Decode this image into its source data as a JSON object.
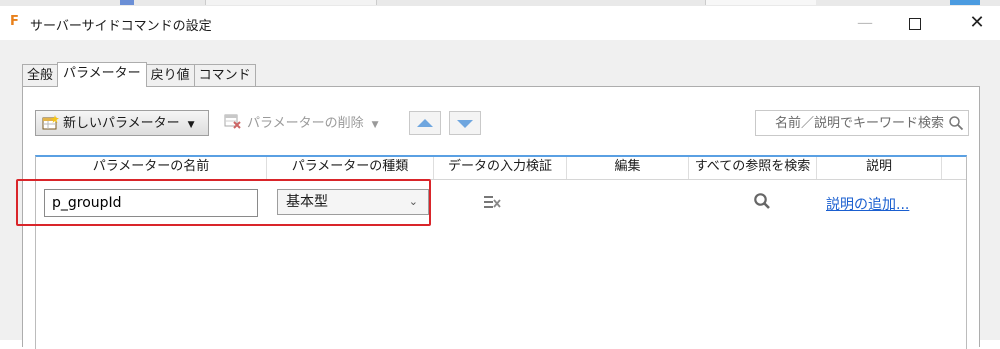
{
  "window": {
    "title": "サーバーサイドコマンドの設定",
    "app_icon_letter": "F",
    "accent_color": "#e8801a",
    "controls": {
      "minimize": "—",
      "close": "✕"
    }
  },
  "tabs": [
    {
      "label": "全般",
      "active": false
    },
    {
      "label": "パラメーター",
      "active": true
    },
    {
      "label": "戻り値",
      "active": false
    },
    {
      "label": "コマンド",
      "active": false
    }
  ],
  "toolbar": {
    "new_parameter_label": "新しいパラメーター",
    "delete_parameter_label": "パラメーターの削除",
    "move_up_icon": "arrow-up",
    "move_down_icon": "arrow-down",
    "search_placeholder": "名前／説明でキーワード検索"
  },
  "grid": {
    "columns": [
      "パラメーターの名前",
      "パラメーターの種類",
      "データの入力検証",
      "編集",
      "すべての参照を検索",
      "説明"
    ],
    "rows": [
      {
        "name": "p_groupId",
        "type": "基本型",
        "validation_icon": "validation-icon",
        "find_references_icon": "search-icon",
        "description_link": "説明の追加..."
      }
    ]
  },
  "colors": {
    "highlight": "#d9252a",
    "link": "#1a5fd0",
    "grid_header_border": "#5aa0e3"
  }
}
